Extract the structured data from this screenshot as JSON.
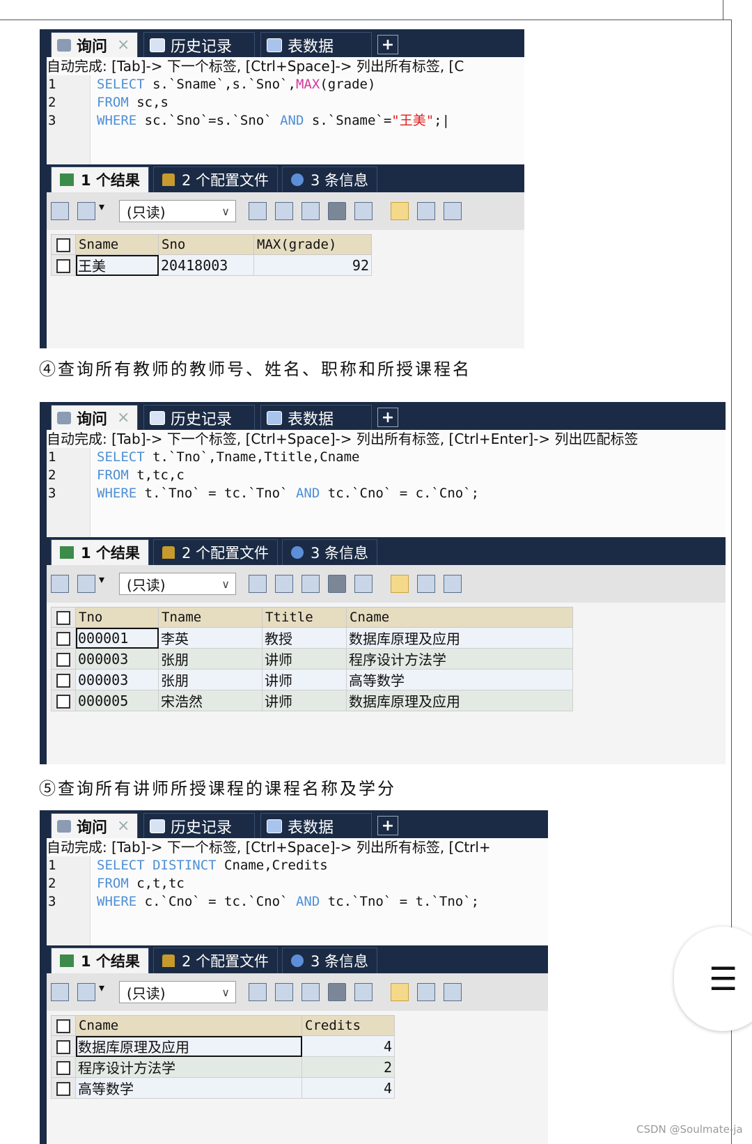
{
  "panels": [
    {
      "tabs": {
        "query": "询问",
        "history": "历史记录",
        "tabledata": "表数据",
        "plus": "+"
      },
      "autocomplete": "自动完成: [Tab]-> 下一个标签, [Ctrl+Space]-> 列出所有标签, [C",
      "lines": [
        {
          "n": "1",
          "parts": [
            [
              "kw",
              "SELECT "
            ],
            [
              "",
              "s.`Sname`,s.`Sno`,"
            ],
            [
              "fn",
              "MAX"
            ],
            [
              "",
              "(grade)"
            ]
          ]
        },
        {
          "n": "2",
          "parts": [
            [
              "kw",
              "FROM "
            ],
            [
              "",
              "sc,s"
            ]
          ]
        },
        {
          "n": "3",
          "parts": [
            [
              "kw",
              "WHERE "
            ],
            [
              "",
              "sc.`Sno`=s.`Sno` "
            ],
            [
              "kw",
              "AND "
            ],
            [
              "",
              "s.`Sname`="
            ],
            [
              "str",
              "\"王美\""
            ],
            [
              "",
              ";|"
            ]
          ]
        }
      ],
      "result_tabs": [
        "1 个结果",
        "2 个配置文件",
        "3 条信息"
      ],
      "readonly": "(只读)",
      "columns": [
        "Sname",
        "Sno",
        "MAX(grade)"
      ],
      "rows": [
        [
          "王美",
          "20418003",
          "92"
        ]
      ]
    },
    {
      "tabs": {
        "query": "询问",
        "history": "历史记录",
        "tabledata": "表数据",
        "plus": "+"
      },
      "autocomplete": "自动完成: [Tab]-> 下一个标签, [Ctrl+Space]-> 列出所有标签, [Ctrl+Enter]-> 列出匹配标签",
      "lines": [
        {
          "n": "1",
          "parts": [
            [
              "kw",
              "SELECT "
            ],
            [
              "",
              "t.`Tno`,Tname,Ttitle,Cname"
            ]
          ]
        },
        {
          "n": "2",
          "parts": [
            [
              "kw",
              "FROM "
            ],
            [
              "",
              "t,tc,c"
            ]
          ]
        },
        {
          "n": "3",
          "parts": [
            [
              "kw",
              "WHERE "
            ],
            [
              "",
              "t.`Tno` = tc.`Tno` "
            ],
            [
              "kw",
              "AND "
            ],
            [
              "",
              "tc.`Cno` = c.`Cno`;"
            ]
          ]
        }
      ],
      "result_tabs": [
        "1 个结果",
        "2 个配置文件",
        "3 条信息"
      ],
      "readonly": "(只读)",
      "columns": [
        "Tno",
        "Tname",
        "Ttitle",
        "Cname"
      ],
      "rows": [
        [
          "000001",
          "李英",
          "教授",
          "数据库原理及应用"
        ],
        [
          "000003",
          "张朋",
          "讲师",
          "程序设计方法学"
        ],
        [
          "000003",
          "张朋",
          "讲师",
          "高等数学"
        ],
        [
          "000005",
          "宋浩然",
          "讲师",
          "数据库原理及应用"
        ]
      ]
    },
    {
      "tabs": {
        "query": "询问",
        "history": "历史记录",
        "tabledata": "表数据",
        "plus": "+"
      },
      "autocomplete": "自动完成: [Tab]-> 下一个标签, [Ctrl+Space]-> 列出所有标签, [Ctrl+",
      "lines": [
        {
          "n": "1",
          "parts": [
            [
              "kw",
              "SELECT DISTINCT "
            ],
            [
              "",
              "Cname,Credits"
            ]
          ]
        },
        {
          "n": "2",
          "parts": [
            [
              "kw",
              "FROM "
            ],
            [
              "",
              "c,t,tc"
            ]
          ]
        },
        {
          "n": "3",
          "parts": [
            [
              "kw",
              "WHERE "
            ],
            [
              "",
              "c.`Cno` = tc.`Cno` "
            ],
            [
              "kw",
              "AND "
            ],
            [
              "",
              "tc.`Tno` = t.`Tno`;"
            ]
          ]
        }
      ],
      "result_tabs": [
        "1 个结果",
        "2 个配置文件",
        "3 条信息"
      ],
      "readonly": "(只读)",
      "columns": [
        "Cname",
        "Credits"
      ],
      "rows": [
        [
          "数据库原理及应用",
          "4"
        ],
        [
          "程序设计方法学",
          "2"
        ],
        [
          "高等数学",
          "4"
        ]
      ]
    }
  ],
  "captions": {
    "c4": "④查询所有教师的教师号、姓名、职称和所授课程名",
    "c5": "⑤查询所有讲师所授课程的课程名称及学分"
  },
  "menu_icon": "☰",
  "watermark": "CSDN @Soulmate-ja",
  "colors": {
    "dark_tab_bar": "#1b2b45",
    "keyword": "#4e8fd6",
    "function": "#d4399a",
    "string": "#e01b1b"
  }
}
